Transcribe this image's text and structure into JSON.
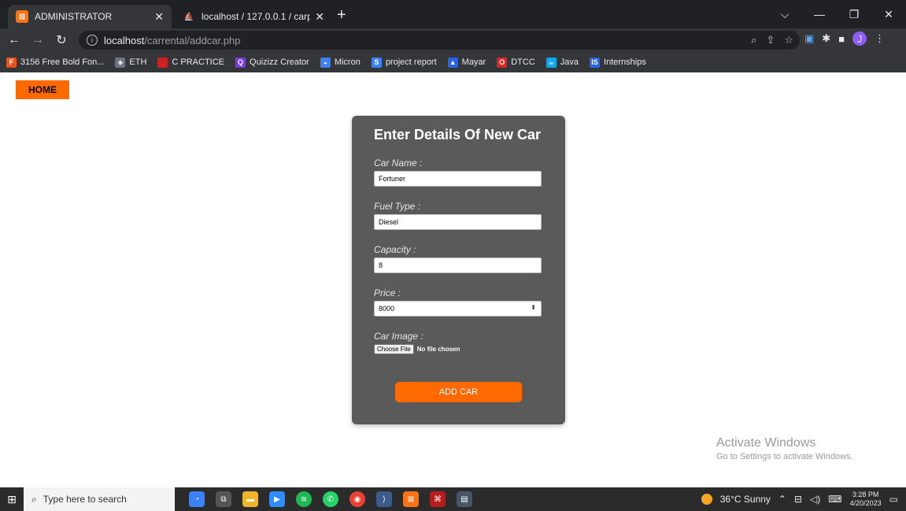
{
  "browser": {
    "tabs": [
      {
        "title": "ADMINISTRATOR",
        "active": true
      },
      {
        "title": "localhost / 127.0.0.1 / carproject",
        "active": false
      }
    ],
    "url_host": "localhost",
    "url_path": "/carrental/addcar.php",
    "avatar_letter": "J",
    "bookmarks": [
      {
        "label": "3156 Free Bold Fon...",
        "icon": "F",
        "color": "#e8531b"
      },
      {
        "label": "ETH",
        "icon": "◈",
        "color": "#6b7280"
      },
      {
        "label": "C PRACTICE",
        "icon": "■",
        "color": "#cc2222"
      },
      {
        "label": "Quizizz Creator",
        "icon": "Q",
        "color": "#7c3aed"
      },
      {
        "label": "Micron",
        "icon": "◒",
        "color": "#3b82f6"
      },
      {
        "label": "project report",
        "icon": "S",
        "color": "#3b82f6"
      },
      {
        "label": "Mayar",
        "icon": "▲",
        "color": "#2563eb"
      },
      {
        "label": "DTCC",
        "icon": "O",
        "color": "#dc2626"
      },
      {
        "label": "Java",
        "icon": "☕",
        "color": "#0ea5e9"
      },
      {
        "label": "Internships",
        "icon": "IS",
        "color": "#2563eb"
      }
    ]
  },
  "page": {
    "home_label": "HOME",
    "form_title": "Enter Details Of New Car",
    "fields": [
      {
        "label": "Car Name :",
        "value": "Fortuner"
      },
      {
        "label": "Fuel Type :",
        "value": "Diesel"
      },
      {
        "label": "Capacity :",
        "value": "8"
      },
      {
        "label": "Price :",
        "value": "8000"
      }
    ],
    "image_label": "Car Image :",
    "file_button": "Choose File",
    "file_status": "No file chosen",
    "submit_label": "ADD CAR",
    "accent": "#ff6a00",
    "card_bg": "#5a5a5a"
  },
  "watermark": {
    "line1": "Activate Windows",
    "line2": "Go to Settings to activate Windows."
  },
  "taskbar": {
    "search_placeholder": "Type here to search",
    "weather": "36°C  Sunny",
    "time": "3:28 PM",
    "date": "4/20/2023"
  }
}
